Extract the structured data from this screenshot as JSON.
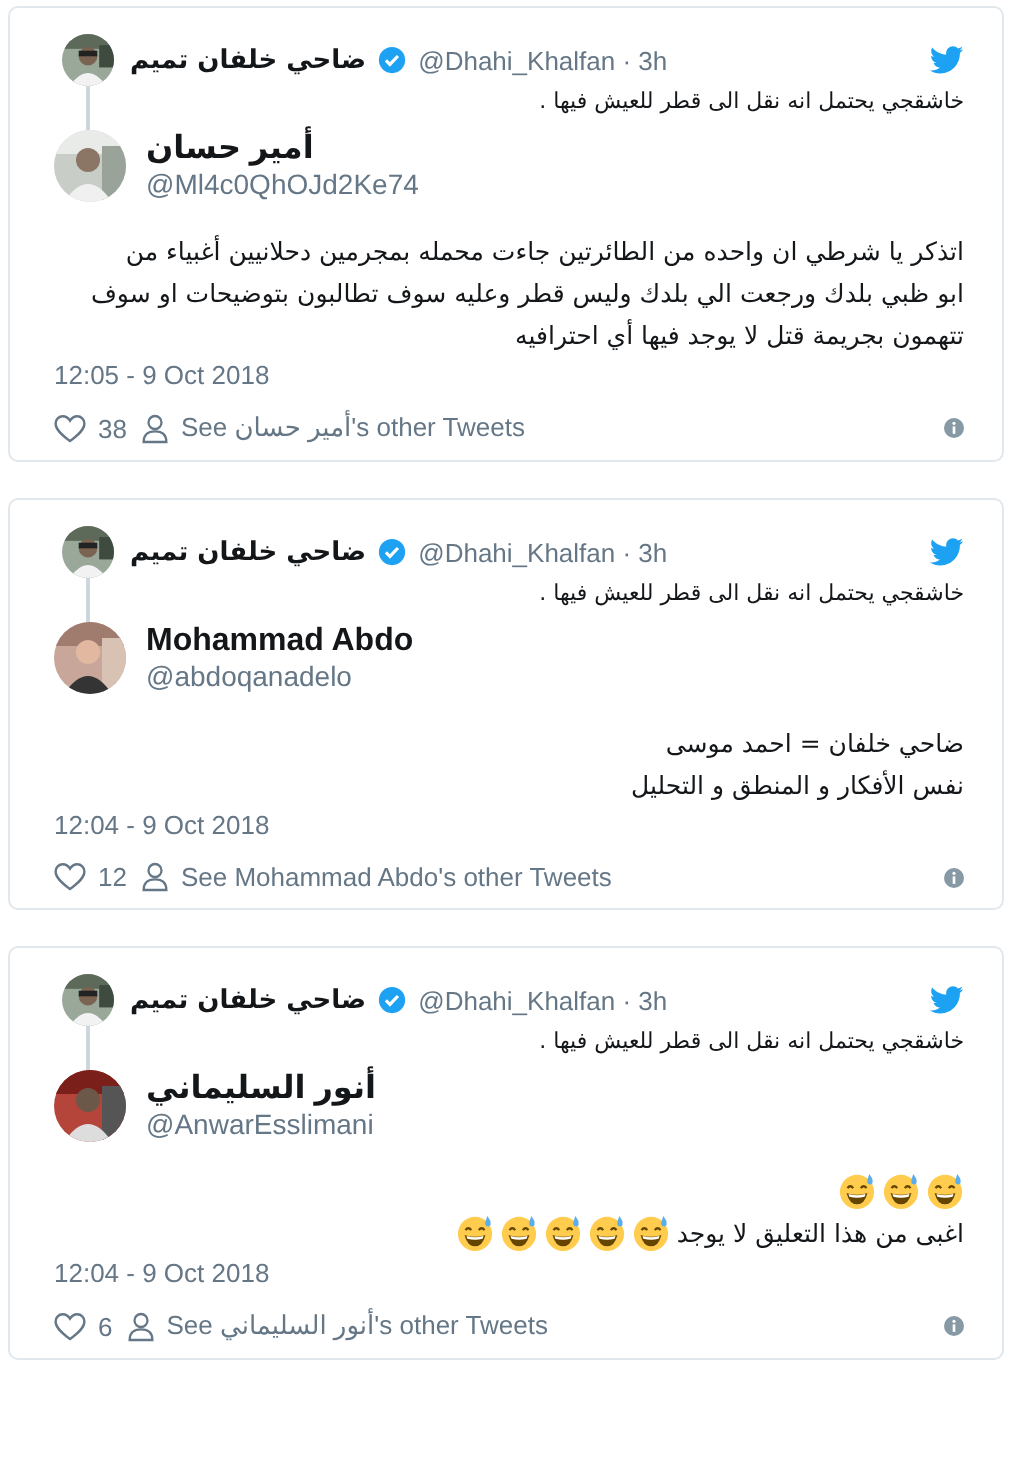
{
  "tweets": [
    {
      "quoted": {
        "name": "ضاحي خلفان تميم",
        "verified": true,
        "handle": "@Dhahi_Khalfan · 3h",
        "text": "خاشقجي يحتمل انه نقل الى قطر للعيش فيها ."
      },
      "author": {
        "name": "أمير حسان",
        "handle": "@Ml4c0QhOJd2Ke74"
      },
      "lines": [
        [
          {
            "kind": "text",
            "text": "اتذكر يا شرطي ان واحده من الطائرتين جاءت محمله بمجرمين دحلانيين أغبياء من"
          }
        ],
        [
          {
            "kind": "text",
            "text": "ابو ظبي بلدك ورجعت الي بلدك وليس قطر وعليه سوف تطالبون بتوضيحات او سوف"
          }
        ],
        [
          {
            "kind": "text",
            "text": "تتهمون بجريمة قتل لا يوجد فيها أي احترافيه"
          }
        ]
      ],
      "time": "12:05 - 9 Oct 2018",
      "likes": "38",
      "see_link": "See أمير حسان's other Tweets"
    },
    {
      "quoted": {
        "name": "ضاحي خلفان تميم",
        "verified": true,
        "handle": "@Dhahi_Khalfan · 3h",
        "text": "خاشقجي يحتمل انه نقل الى قطر للعيش فيها ."
      },
      "author": {
        "name": "Mohammad Abdo",
        "handle": "@abdoqanadelo"
      },
      "lines": [
        [
          {
            "kind": "text",
            "text": "ضاحي خلفان = احمد موسى"
          }
        ],
        [
          {
            "kind": "text",
            "text": "نفس الأفكار و المنطق و التحليل"
          }
        ]
      ],
      "time": "12:04 - 9 Oct 2018",
      "likes": "12",
      "see_link": "See Mohammad Abdo's other Tweets"
    },
    {
      "quoted": {
        "name": "ضاحي خلفان تميم",
        "verified": true,
        "handle": "@Dhahi_Khalfan · 3h",
        "text": "خاشقجي يحتمل انه نقل الى قطر للعيش فيها ."
      },
      "author": {
        "name": "أنور السليماني",
        "handle": "@AnwarEsslimani"
      },
      "lines": [
        [
          {
            "kind": "emoji"
          },
          {
            "kind": "emoji"
          },
          {
            "kind": "emoji"
          }
        ],
        [
          {
            "kind": "text",
            "text": "اغبى من هذا التعليق لا يوجد"
          },
          {
            "kind": "emoji"
          },
          {
            "kind": "emoji"
          },
          {
            "kind": "emoji"
          },
          {
            "kind": "emoji"
          },
          {
            "kind": "emoji"
          }
        ]
      ],
      "time": "12:04 - 9 Oct 2018",
      "likes": "6",
      "see_link": "See أنور السليماني's other Tweets"
    }
  ]
}
